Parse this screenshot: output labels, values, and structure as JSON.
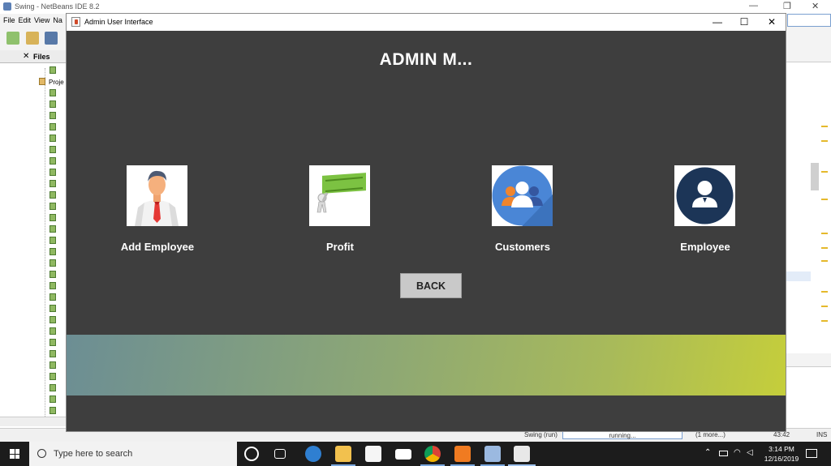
{
  "ide": {
    "title": "Swing - NetBeans IDE 8.2",
    "menu": [
      "File",
      "Edit",
      "View",
      "Na"
    ],
    "files_tab": "Files",
    "projects_node": "Proje",
    "status": {
      "task": "Swing (run)",
      "progress_text": "running...",
      "more": "(1 more...)",
      "position": "43:42",
      "mode": "INS"
    }
  },
  "taskbar": {
    "search_placeholder": "Type here to search",
    "time": "3:14 PM",
    "date": "12/16/2019",
    "icons": [
      "task-view-icon",
      "edge-icon",
      "file-explorer-icon",
      "store-icon",
      "mail-icon",
      "chrome-icon",
      "xampp-icon",
      "virtualbox-icon",
      "java-icon"
    ]
  },
  "window": {
    "title": "Admin User Interface",
    "heading": "ADMIN M...",
    "menu_items": [
      {
        "label": "Add Employee",
        "icon": "employee-avatar-icon"
      },
      {
        "label": "Profit",
        "icon": "profit-icon"
      },
      {
        "label": "Customers",
        "icon": "customers-icon"
      },
      {
        "label": "Employee",
        "icon": "employee-user-icon"
      }
    ],
    "back_label": "BACK",
    "colors": {
      "background": "#3e3e3e",
      "heading": "#ffffff",
      "button": "#c9c9c9",
      "footer_start": "#6c8e94",
      "footer_end": "#c5ce3b"
    }
  }
}
